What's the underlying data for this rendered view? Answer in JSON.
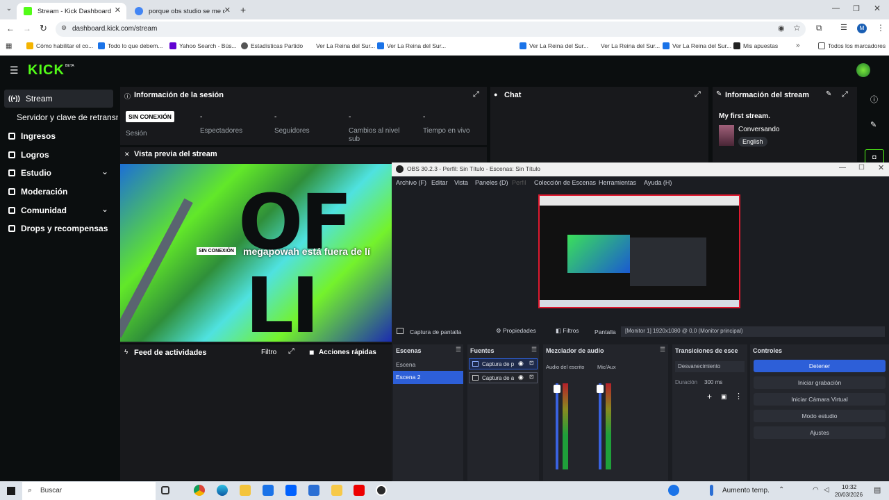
{
  "browser": {
    "tabs": [
      {
        "title": "Stream - Kick Dashboard",
        "active": true,
        "color": "#53fc18"
      },
      {
        "title": "porque obs studio se me desc",
        "active": false,
        "color": "#4285f4"
      }
    ],
    "url": "dashboard.kick.com/stream",
    "bookmarks": [
      {
        "label": "Cómo habilitar el co...",
        "color": "#f4b400"
      },
      {
        "label": "Todo lo que debem...",
        "color": "#1a73e8"
      },
      {
        "label": "Yahoo Search - Bús...",
        "color": "#6001d2"
      },
      {
        "label": "Estadísticas Partido",
        "color": "#555555"
      },
      {
        "label": "Ver La Reina del Sur...",
        "color": "#ffffff"
      },
      {
        "label": "Ver La Reina del Sur...",
        "color": "#1a73e8"
      },
      {
        "label": "Ver La Reina del Sur...",
        "color": "#1a73e8"
      },
      {
        "label": "Ver La Reina del Sur...",
        "color": "#ffffff"
      },
      {
        "label": "Ver La Reina del Sur...",
        "color": "#1a73e8"
      },
      {
        "label": "Mis apuestas",
        "color": "#222222"
      }
    ],
    "all_bookmarks": "Todos los marcadores",
    "profile_initial": "M"
  },
  "kick": {
    "logo": "KICK",
    "logo_sup": "BETA",
    "accent": "#53fc18",
    "nav": [
      {
        "label": "Stream",
        "icon": "broadcast-icon"
      },
      {
        "label": "Servidor y clave de retransmisión",
        "icon": ""
      },
      {
        "label": "Ingresos",
        "icon": "money-icon"
      },
      {
        "label": "Logros",
        "icon": "trophy-icon"
      },
      {
        "label": "Estudio",
        "icon": "studio-icon"
      },
      {
        "label": "Moderación",
        "icon": "wrench-icon"
      },
      {
        "label": "Comunidad",
        "icon": "people-icon"
      },
      {
        "label": "Drops y recompensas",
        "icon": "gift-icon"
      }
    ],
    "session": {
      "title": "Información de la sesión",
      "badge": "SIN CONEXIÓN",
      "session_label": "Sesión",
      "stats": [
        {
          "value": "-",
          "label": "Espectadores"
        },
        {
          "value": "-",
          "label": "Seguidores"
        },
        {
          "value": "-",
          "label": "Cambios al nivel sub"
        },
        {
          "value": "-",
          "label": "Tiempo en vivo"
        }
      ]
    },
    "chat": {
      "title": "Chat"
    },
    "stream_info": {
      "title": "Información del stream",
      "stream_title": "My first stream.",
      "category": "Conversando",
      "language": "English"
    },
    "preview": {
      "title": "Vista previa del stream",
      "badge": "SIN CONEXIÓN",
      "message": "megapowah está fuera de lí"
    },
    "activity": {
      "title": "Feed de actividades",
      "filter": "Filtro",
      "quick_actions": "Acciones rápidas"
    }
  },
  "obs": {
    "title": "OBS 30.2.3 - Perfil: Sin Título - Escenas: Sin Título",
    "menu": [
      "Archivo (F)",
      "Editar",
      "Vista",
      "Paneles (D)",
      "Perfil",
      "Colección de Escenas",
      "Herramientas",
      "Ayuda (H)"
    ],
    "source_bar": {
      "source": "Captura de pantalla",
      "properties": "Propiedades",
      "filters": "Filtros",
      "screen_label": "Pantalla",
      "screen_value": "[Monitor 1] 1920x1080 @ 0,0 (Monitor principal)"
    },
    "docks": {
      "scenes": {
        "title": "Escenas",
        "items": [
          "Escena",
          "Escena 2"
        ],
        "selected": 1
      },
      "sources": {
        "title": "Fuentes",
        "items": [
          "Captura de pantalla",
          "Captura de audio"
        ]
      },
      "mixer": {
        "title": "Mezclador de audio",
        "channels": [
          "Audio del escritorio",
          "Mic/Aux"
        ]
      },
      "transitions": {
        "title": "Transiciones de escena",
        "type": "Desvanecimiento",
        "duration_label": "Duración",
        "duration": "300 ms"
      },
      "controls": {
        "title": "Controles",
        "buttons": [
          "Detener",
          "Iniciar grabación",
          "Iniciar Cámara Virtual",
          "Modo estudio",
          "Ajustes"
        ]
      }
    }
  },
  "taskbar": {
    "search": "Buscar",
    "weather": "Aumento temp.",
    "time": "10:32",
    "date": "20/03/2026"
  }
}
